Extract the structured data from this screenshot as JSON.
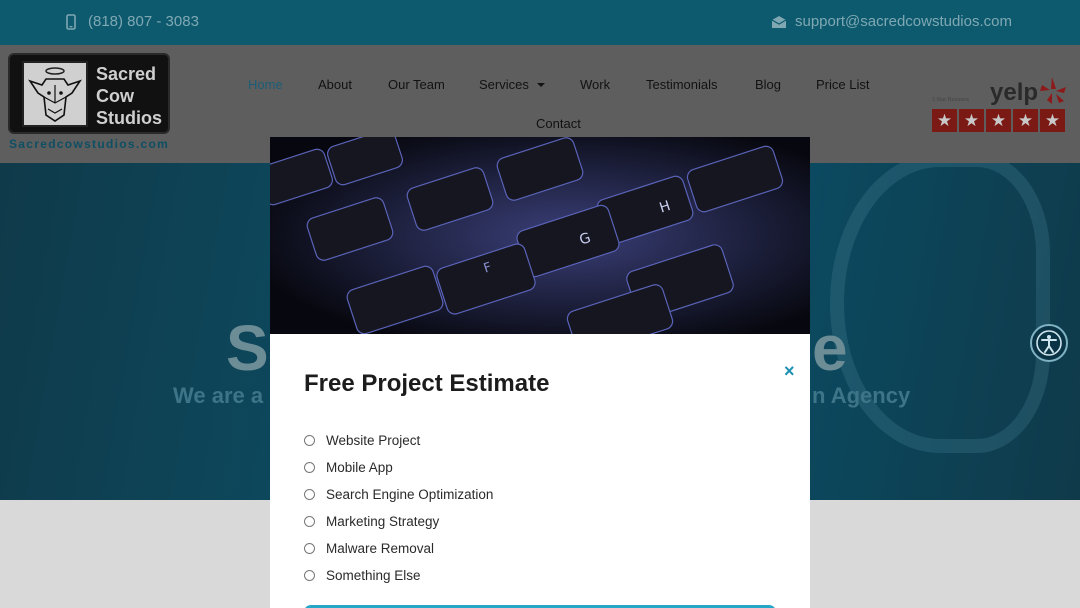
{
  "topbar": {
    "phone": "(818) 807 - 3083",
    "email": "support@sacredcowstudios.com"
  },
  "logo": {
    "line1": "Sacred",
    "line2": "Cow",
    "line3": "Studios",
    "url": "Sacredcowstudios.com"
  },
  "nav": {
    "items": [
      "Home",
      "About",
      "Our Team",
      "Services",
      "Work",
      "Testimonials",
      "Blog",
      "Price List",
      "Contact"
    ],
    "active": "Home"
  },
  "yelp": {
    "small": "5 Star Business",
    "word": "yelp",
    "stars": 5
  },
  "hero": {
    "title_left": "S",
    "title_right": "e",
    "sub_left": "We are a",
    "sub_right": "n Agency"
  },
  "modal": {
    "title": "Free Project Estimate",
    "close": "×",
    "options": [
      "Website Project",
      "Mobile App",
      "Search Engine Optimization",
      "Marketing Strategy",
      "Malware Removal",
      "Something Else"
    ]
  },
  "colors": {
    "topbar": "#0d5a6e",
    "accent": "#26a7c9",
    "header": "#5e5e5e",
    "yelp": "#7b1a14"
  }
}
